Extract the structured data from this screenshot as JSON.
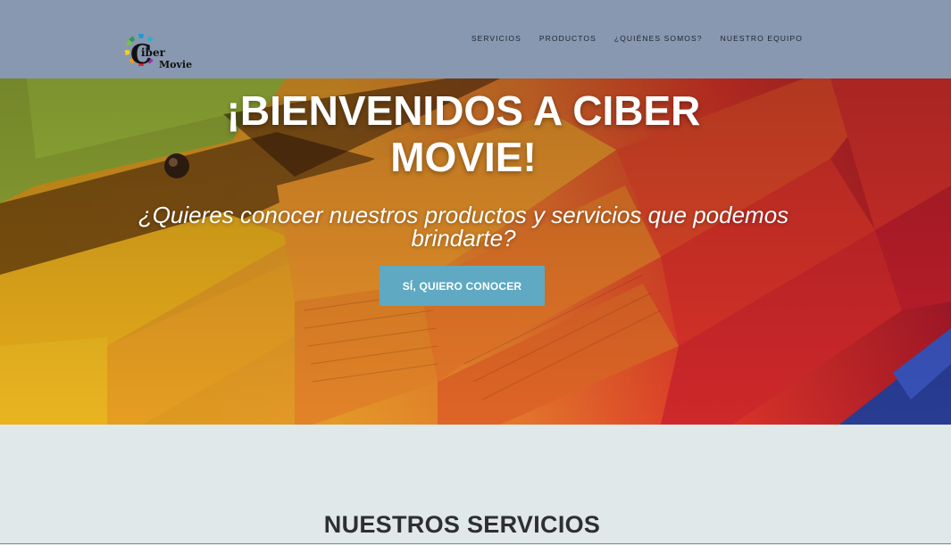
{
  "header": {
    "logo": {
      "line1": "iber",
      "line2": "Movie",
      "letter": "C"
    },
    "nav": [
      {
        "label": "SERVICIOS"
      },
      {
        "label": "PRODUCTOS"
      },
      {
        "label": "¿QUIÉNES SOMOS?"
      },
      {
        "label": "NUESTRO EQUIPO"
      }
    ]
  },
  "hero": {
    "title_line1": "¡BIENVENIDOS A CIBER",
    "title_line2": "MOVIE!",
    "subtitle_line1": "¿Quieres conocer nuestros productos y servicios que podemos",
    "subtitle_line2": "brindarte?",
    "button_label": "SÍ, QUIERO CONOCER"
  },
  "services": {
    "title": "NUESTROS SERVICIOS"
  },
  "colors": {
    "navbar": "#8898b1",
    "button": "#5fa9c2",
    "section_bg": "#e1e8ea"
  }
}
